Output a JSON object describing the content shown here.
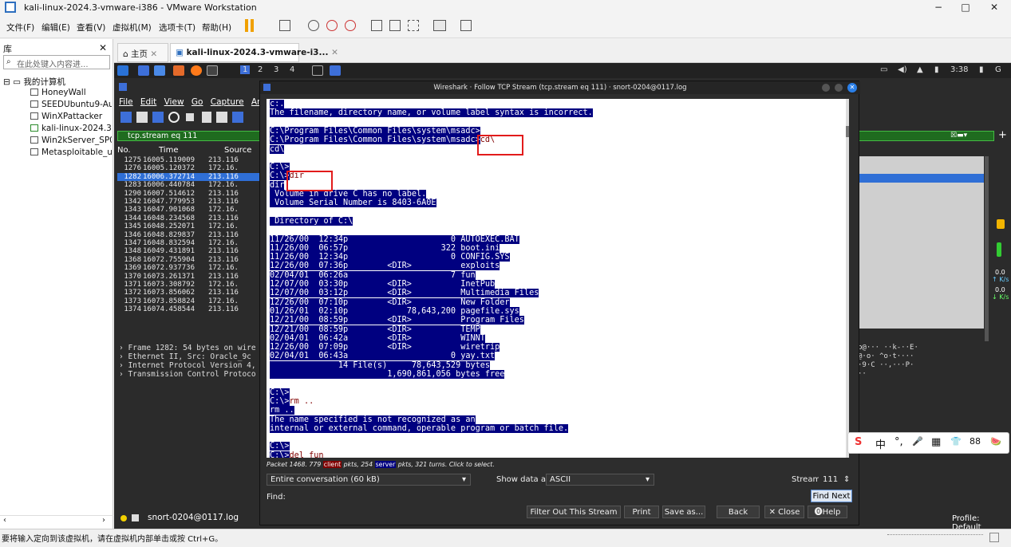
{
  "window": {
    "title": "kali-linux-2024.3-vmware-i386 - VMware Workstation",
    "min": "−",
    "max": "□",
    "close": "✕"
  },
  "menubar": [
    "文件(F)",
    "编辑(E)",
    "查看(V)",
    "虚拟机(M)",
    "选项卡(T)",
    "帮助(H)"
  ],
  "library": {
    "title": "库",
    "close": "✕",
    "search_placeholder": "在此处键入内容进...",
    "root": "我的计算机",
    "items": [
      "HoneyWall",
      "SEEDUbuntu9-Au",
      "WinXPattacker",
      "kali-linux-2024.3-",
      "Win2kServer_SP0",
      "Metasploitable_u"
    ]
  },
  "tabs": {
    "home": "主页",
    "vm": "kali-linux-2024.3-vmware-i3..."
  },
  "kali": {
    "workspaces": [
      "1",
      "2",
      "3",
      "4"
    ],
    "time": "3:38"
  },
  "wireshark": {
    "menu": [
      "File",
      "Edit",
      "View",
      "Go",
      "Capture",
      "Anal"
    ],
    "filter": "tcp.stream eq 111",
    "columns": {
      "no": "No.",
      "time": "Time",
      "source": "Source"
    },
    "packets": [
      {
        "no": "1275",
        "time": "16005.119009",
        "src": "213.116"
      },
      {
        "no": "1276",
        "time": "16005.120372",
        "src": "172.16."
      },
      {
        "no": "1282",
        "time": "16006.372714",
        "src": "213.116",
        "sel": true
      },
      {
        "no": "1283",
        "time": "16006.440784",
        "src": "172.16."
      },
      {
        "no": "1290",
        "time": "16007.514612",
        "src": "213.116"
      },
      {
        "no": "1342",
        "time": "16047.779953",
        "src": "213.116"
      },
      {
        "no": "1343",
        "time": "16047.901068",
        "src": "172.16."
      },
      {
        "no": "1344",
        "time": "16048.234568",
        "src": "213.116"
      },
      {
        "no": "1345",
        "time": "16048.252071",
        "src": "172.16."
      },
      {
        "no": "1346",
        "time": "16048.829837",
        "src": "213.116"
      },
      {
        "no": "1347",
        "time": "16048.832594",
        "src": "172.16."
      },
      {
        "no": "1348",
        "time": "16049.431891",
        "src": "213.116"
      },
      {
        "no": "1368",
        "time": "16072.755904",
        "src": "213.116"
      },
      {
        "no": "1369",
        "time": "16072.937736",
        "src": "172.16."
      },
      {
        "no": "1370",
        "time": "16073.261371",
        "src": "213.116"
      },
      {
        "no": "1371",
        "time": "16073.308792",
        "src": "172.16."
      },
      {
        "no": "1372",
        "time": "16073.856062",
        "src": "213.116"
      },
      {
        "no": "1373",
        "time": "16073.858824",
        "src": "172.16."
      },
      {
        "no": "1374",
        "time": "16074.458544",
        "src": "213.116"
      }
    ],
    "details": [
      "Frame 1282: 54 bytes on wire",
      "Ethernet II, Src: Oracle_9c",
      "Internet Protocol Version 4,",
      "Transmission Control Protoco"
    ],
    "hex": [
      "p@···  ··k-··E·",
      "@·o· ^o·t····",
      "·9·C ··,···P·",
      "··"
    ],
    "status": "snort-0204@0117.log",
    "profile": "Profile: Default"
  },
  "dialog": {
    "title": "Wireshark · Follow TCP Stream (tcp.stream eq 111) · snort-0204@0117.log",
    "lines": [
      {
        "t": "c:.",
        "k": "srv"
      },
      {
        "t": "The filename, directory name, or volume label syntax is incorrect.",
        "k": "srv"
      },
      {
        "t": "",
        "k": "none"
      },
      {
        "t": "C:\\Program Files\\Common Files\\system\\msadc>",
        "k": "srv"
      },
      {
        "t": "C:\\Program Files\\Common Files\\system\\msadc>",
        "k": "srv",
        "c": "cd\\"
      },
      {
        "t": "cd\\",
        "k": "srv"
      },
      {
        "t": "",
        "k": "none"
      },
      {
        "t": "C:\\>",
        "k": "srv"
      },
      {
        "t": "C:\\>",
        "k": "srv",
        "c": "dir"
      },
      {
        "t": "dir",
        "k": "srv"
      },
      {
        "t": " Volume in drive C has no label.",
        "k": "srv"
      },
      {
        "t": " Volume Serial Number is 8403-6A0E",
        "k": "srv"
      },
      {
        "t": "",
        "k": "none"
      },
      {
        "t": " Directory of C:\\",
        "k": "srv"
      },
      {
        "t": "",
        "k": "none"
      },
      {
        "t": "11/26/00  12:34p                     0 AUTOEXEC.BAT",
        "k": "srv"
      },
      {
        "t": "11/26/00  06:57p                   322 boot.ini",
        "k": "srv"
      },
      {
        "t": "11/26/00  12:34p                     0 CONFIG.SYS",
        "k": "srv"
      },
      {
        "t": "12/26/00  07:36p        <DIR>          exploits",
        "k": "srv"
      },
      {
        "t": "02/04/01  06:26a                     7 fun",
        "k": "srv"
      },
      {
        "t": "12/07/00  03:30p        <DIR>          InetPub",
        "k": "srv"
      },
      {
        "t": "12/07/00  03:12p        <DIR>          Multimedia Files",
        "k": "srv"
      },
      {
        "t": "12/26/00  07:10p        <DIR>          New Folder",
        "k": "srv"
      },
      {
        "t": "01/26/01  02:10p            78,643,200 pagefile.sys",
        "k": "srv"
      },
      {
        "t": "12/21/00  08:59p        <DIR>          Program Files",
        "k": "srv"
      },
      {
        "t": "12/21/00  08:59p        <DIR>          TEMP",
        "k": "srv"
      },
      {
        "t": "02/04/01  06:42a        <DIR>          WINNT",
        "k": "srv"
      },
      {
        "t": "12/26/00  07:09p        <DIR>          wiretrip",
        "k": "srv"
      },
      {
        "t": "02/04/01  06:43a                     0 yay.txt",
        "k": "srv"
      },
      {
        "t": "              14 File(s)     78,643,529 bytes",
        "k": "srv"
      },
      {
        "t": "                        1,690,861,056 bytes free",
        "k": "srv"
      },
      {
        "t": "",
        "k": "none"
      },
      {
        "t": "C:\\>",
        "k": "srv"
      },
      {
        "t": "C:\\>",
        "k": "srv",
        "c": "rm .."
      },
      {
        "t": "rm ..",
        "k": "srv"
      },
      {
        "t": "The name specified is not recognized as an",
        "k": "srv"
      },
      {
        "t": "internal or external command, operable program or batch file.",
        "k": "srv"
      },
      {
        "t": "",
        "k": "none"
      },
      {
        "t": "C:\\>",
        "k": "srv"
      },
      {
        "t": "C:\\>",
        "k": "srv",
        "c": "del fun"
      }
    ],
    "info": {
      "pre": "Packet 1468. 779 ",
      "client": "client",
      "mid": " pkts, 254 ",
      "server": "server",
      "post": " pkts, 321 turns. Click to select."
    },
    "conversation": "Entire conversation (60 kB)",
    "show_as_label": "Show data as",
    "show_as": "ASCII",
    "stream_label": "Stream",
    "stream": "111",
    "find_label": "Find:",
    "find_next": "Find Next",
    "buttons": {
      "filter_out": "Filter Out This Stream",
      "print": "Print",
      "save_as": "Save as...",
      "back": "Back",
      "close": "✕ Close",
      "help": "Help"
    }
  },
  "tray": {
    "speed1": "0.0",
    "speed1u": "↑ K/s",
    "speed2": "0.0",
    "speed2u": "↓ K/s"
  },
  "ime": [
    "S",
    "中",
    "°,",
    "🎤",
    "▦",
    "👕",
    "88",
    "🍉"
  ],
  "statusbar": "要将输入定向到该虚拟机，请在虚拟机内部单击或按 Ctrl+G。"
}
